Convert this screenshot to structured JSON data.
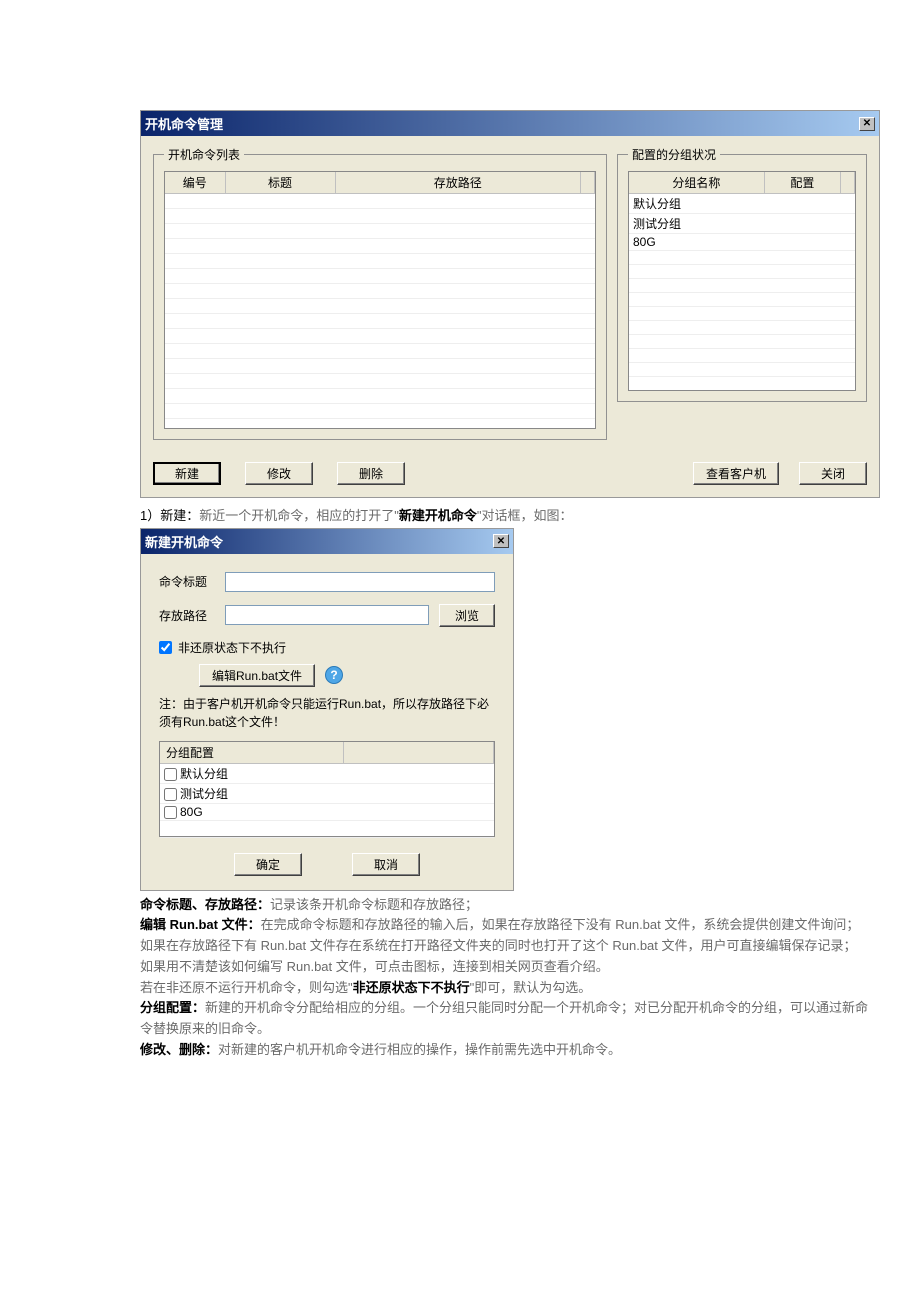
{
  "main": {
    "title": "开机命令管理",
    "list_legend": "开机命令列表",
    "cols": {
      "id": "编号",
      "title_col": "标题",
      "path": "存放路径"
    },
    "groups_legend": "配置的分组状况",
    "group_cols": {
      "name": "分组名称",
      "cfg": "配置"
    },
    "group_rows": [
      "默认分组",
      "测试分组",
      "80G"
    ],
    "buttons": {
      "new": "新建",
      "edit": "修改",
      "del": "删除",
      "view_clients": "查看客户机",
      "close": "关闭"
    }
  },
  "intro": {
    "prefix": "1）新建：",
    "body_gray": "新近一个开机命令，相应的打开了\"",
    "bold": "新建开机命令",
    "suffix": "\"对话框，如图："
  },
  "dlg": {
    "title": "新建开机命令",
    "labels": {
      "cmd_title": "命令标题",
      "path": "存放路径"
    },
    "browse": "浏览",
    "chk": "非还原状态下不执行",
    "edit_bat": "编辑Run.bat文件",
    "note": "注：由于客户机开机命令只能运行Run.bat，所以存放路径下必须有Run.bat这个文件！",
    "cfg_col": "分组配置",
    "cfg_rows": [
      "默认分组",
      "测试分组",
      "80G"
    ],
    "ok": "确定",
    "cancel": "取消"
  },
  "desc": {
    "l1_b": "命令标题、存放路径：",
    "l1": "记录该条开机命令标题和存放路径；",
    "l2_b": "编辑 Run.bat 文件：",
    "l2": "在完成命令标题和存放路径的输入后，如果在存放路径下没有 Run.bat 文件，系统会提供创建文件询问；",
    "l3": "如果在存放路径下有 Run.bat 文件存在系统在打开路径文件夹的同时也打开了这个 Run.bat 文件，用户可直接编辑保存记录；",
    "l4": "如果用不清楚该如何编写 Run.bat 文件，可点击图标，连接到相关网页查看介绍。",
    "l5_pre": "若在非还原不运行开机命令，则勾选\"",
    "l5_b": "非还原状态下不执行",
    "l5_post": "\"即可，默认为勾选。",
    "l6_b": "分组配置：",
    "l6": "新建的开机命令分配给相应的分组。一个分组只能同时分配一个开机命令；对已分配开机命令的分组，可以通过新命令替换原来的旧命令。",
    "l7_b": "修改、删除：",
    "l7": "对新建的客户机开机命令进行相应的操作，操作前需先选中开机命令。"
  }
}
